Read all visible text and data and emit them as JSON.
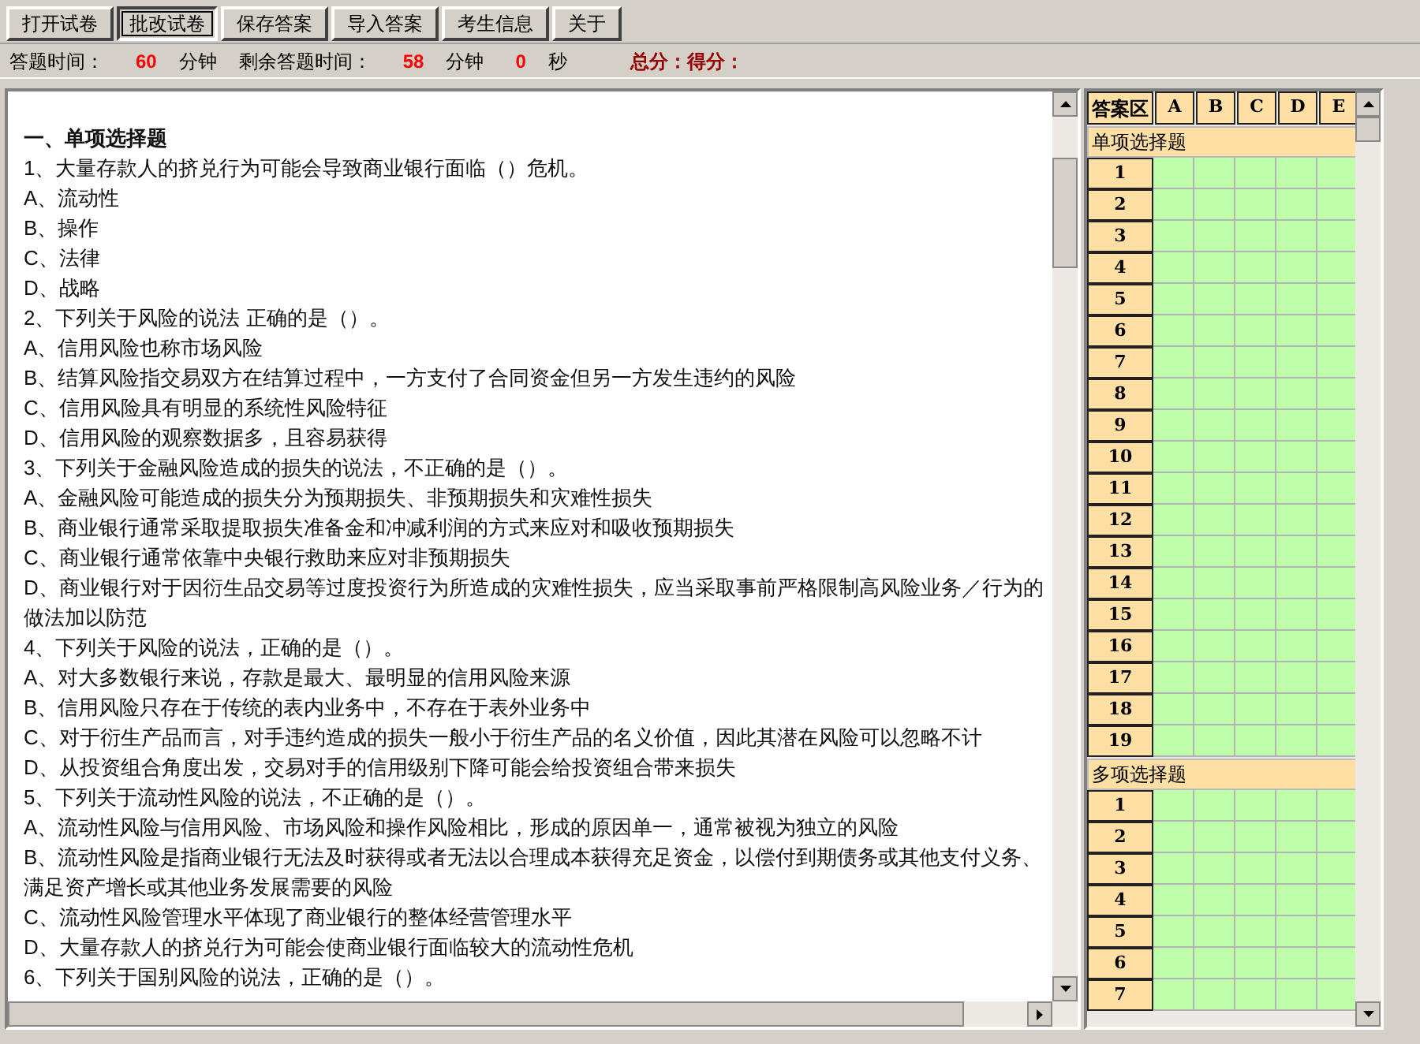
{
  "toolbar": [
    {
      "label": "打开试卷",
      "pressed": false
    },
    {
      "label": "批改试卷",
      "pressed": true
    },
    {
      "label": "保存答案",
      "pressed": false
    },
    {
      "label": "导入答案",
      "pressed": false
    },
    {
      "label": "考生信息",
      "pressed": false
    },
    {
      "label": "关于",
      "pressed": false
    }
  ],
  "info_bar": [
    {
      "text": "答题时间：",
      "kind": "label"
    },
    {
      "text": "60",
      "kind": "value"
    },
    {
      "text": "分钟",
      "kind": "label"
    },
    {
      "text": "剩余答题时间：",
      "kind": "label"
    },
    {
      "text": "58",
      "kind": "value"
    },
    {
      "text": "分钟",
      "kind": "label"
    },
    {
      "text": "0",
      "kind": "value"
    },
    {
      "text": "秒",
      "kind": "label"
    },
    {
      "text": "总分：得分：",
      "kind": "score"
    }
  ],
  "exam": [
    {
      "kind": "heading",
      "text": "一、单项选择题"
    },
    {
      "kind": "question",
      "text": "1、大量存款人的挤兑行为可能会导致商业银行面临（）危机。"
    },
    {
      "kind": "option",
      "text": "A、流动性"
    },
    {
      "kind": "option",
      "text": "B、操作"
    },
    {
      "kind": "option",
      "text": "C、法律"
    },
    {
      "kind": "option",
      "text": "D、战略"
    },
    {
      "kind": "question",
      "text": "2、下列关于风险的说法 正确的是（）。"
    },
    {
      "kind": "option",
      "text": "A、信用风险也称市场风险"
    },
    {
      "kind": "option",
      "text": "B、结算风险指交易双方在结算过程中，一方支付了合同资金但另一方发生违约的风险"
    },
    {
      "kind": "option",
      "text": "C、信用风险具有明显的系统性风险特征"
    },
    {
      "kind": "option",
      "text": "D、信用风险的观察数据多，且容易获得"
    },
    {
      "kind": "question",
      "text": "3、下列关于金融风险造成的损失的说法，不正确的是（）。"
    },
    {
      "kind": "option",
      "text": "A、金融风险可能造成的损失分为预期损失、非预期损失和灾难性损失"
    },
    {
      "kind": "option",
      "text": "B、商业银行通常采取提取损失准备金和冲减利润的方式来应对和吸收预期损失"
    },
    {
      "kind": "option",
      "text": "C、商业银行通常依靠中央银行救助来应对非预期损失"
    },
    {
      "kind": "option",
      "text": "D、商业银行对于因衍生品交易等过度投资行为所造成的灾难性损失，应当采取事前严格限制高风险业务／行为的做法加以防范"
    },
    {
      "kind": "question",
      "text": "4、下列关于风险的说法，正确的是（）。"
    },
    {
      "kind": "option",
      "text": "A、对大多数银行来说，存款是最大、最明显的信用风险来源"
    },
    {
      "kind": "option",
      "text": "B、信用风险只存在于传统的表内业务中，不存在于表外业务中"
    },
    {
      "kind": "option",
      "text": "C、对于衍生产品而言，对手违约造成的损失一般小于衍生产品的名义价值，因此其潜在风险可以忽略不计"
    },
    {
      "kind": "option",
      "text": "D、从投资组合角度出发，交易对手的信用级别下降可能会给投资组合带来损失"
    },
    {
      "kind": "question",
      "text": "5、下列关于流动性风险的说法，不正确的是（）。"
    },
    {
      "kind": "option",
      "text": "A、流动性风险与信用风险、市场风险和操作风险相比，形成的原因单一，通常被视为独立的风险"
    },
    {
      "kind": "option",
      "text": "B、流动性风险是指商业银行无法及时获得或者无法以合理成本获得充足资金，以偿付到期债务或其他支付义务、满足资产增长或其他业务发展需要的风险"
    },
    {
      "kind": "option",
      "text": "C、流动性风险管理水平体现了商业银行的整体经营管理水平"
    },
    {
      "kind": "option",
      "text": "D、大量存款人的挤兑行为可能会使商业银行面临较大的流动性危机"
    },
    {
      "kind": "question",
      "text": "6、下列关于国别风险的说法，正确的是（）。"
    }
  ],
  "answer_sheet": {
    "corner": "答案区",
    "columns": [
      "A",
      "B",
      "C",
      "D",
      "E"
    ],
    "sections": [
      {
        "title": "单项选择题",
        "rows": [
          "1",
          "2",
          "3",
          "4",
          "5",
          "6",
          "7",
          "8",
          "9",
          "10",
          "11",
          "12",
          "13",
          "14",
          "15",
          "16",
          "17",
          "18",
          "19"
        ]
      },
      {
        "title": "多项选择题",
        "rows": [
          "1",
          "2",
          "3",
          "4",
          "5",
          "6",
          "7"
        ]
      }
    ]
  }
}
